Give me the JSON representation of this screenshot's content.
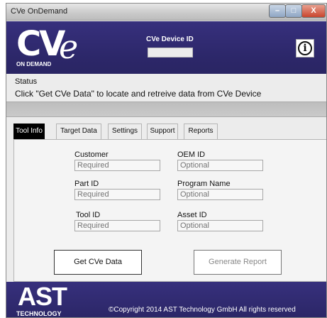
{
  "window": {
    "title": "CVe OnDemand",
    "controls": {
      "minimize": "–",
      "maximize": "□",
      "close": "X"
    }
  },
  "header": {
    "logo_main": "CV",
    "logo_accent": "e",
    "logo_subtitle": "ON DEMAND",
    "device_id_label": "CVe Device ID",
    "device_id_value": "",
    "info_icon": "info-icon",
    "info_glyph": "i"
  },
  "status": {
    "label": "Status",
    "message": "Click \"Get CVe Data\" to locate and retreive data from CVe Device"
  },
  "tabs": [
    {
      "label": "Tool Info",
      "active": true
    },
    {
      "label": "Target Data",
      "active": false
    },
    {
      "label": "Settings",
      "active": false
    },
    {
      "label": "Support",
      "active": false
    },
    {
      "label": "Reports",
      "active": false
    }
  ],
  "form": {
    "customer": {
      "label": "Customer",
      "placeholder": "Required"
    },
    "oem_id": {
      "label": "OEM ID",
      "placeholder": "Optional"
    },
    "part_id": {
      "label": "Part ID",
      "placeholder": "Required"
    },
    "program_name": {
      "label": "Program Name",
      "placeholder": "Optional"
    },
    "tool_id": {
      "label": "Tool ID",
      "placeholder": "Required"
    },
    "asset_id": {
      "label": "Asset ID",
      "placeholder": "Optional"
    }
  },
  "buttons": {
    "get_data": "Get CVe Data",
    "generate_report": "Generate Report"
  },
  "footer": {
    "logo_main": "AST",
    "logo_subtitle": "TECHNOLOGY",
    "copyright": "©Copyright 2014 AST Technology GmbH  All rights reserved"
  },
  "colors": {
    "brand_navy": "#2c2769",
    "active_tab": "#000000"
  }
}
